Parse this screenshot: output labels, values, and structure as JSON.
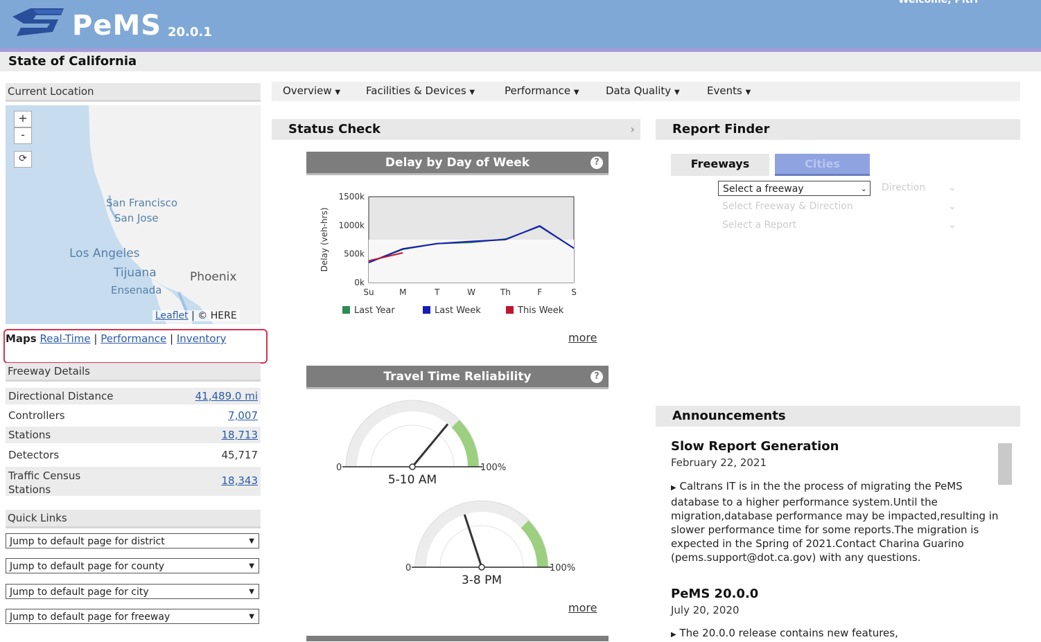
{
  "header": {
    "app_name": "PeMS",
    "version": "20.0.1",
    "welcome": "Welcome, Pitri",
    "state_title": "State of California"
  },
  "left": {
    "current_location_title": "Current Location",
    "map": {
      "zoom_in": "+",
      "zoom_out": "-",
      "cities": [
        "San Francisco",
        "San Jose",
        "Los Angeles",
        "Tijuana",
        "Ensenada",
        "Phoenix"
      ],
      "attribution_leaflet": "Leaflet",
      "attribution_here": "© HERE"
    },
    "map_links": {
      "label": "Maps",
      "realtime": "Real-Time",
      "performance": "Performance",
      "inventory": "Inventory"
    },
    "freeway_details": {
      "title": "Freeway Details",
      "rows": [
        {
          "label": "Directional Distance",
          "value": "41,489.0 mi"
        },
        {
          "label": "Controllers",
          "value": "7,007"
        },
        {
          "label": "Stations",
          "value": "18,713"
        },
        {
          "label": "Detectors",
          "value": "45,717"
        },
        {
          "label": "Traffic Census Stations",
          "value": "18,343"
        }
      ]
    },
    "quick_links": {
      "title": "Quick Links",
      "options": [
        "Jump to default page for district",
        "Jump to default page for county",
        "Jump to default page for city",
        "Jump to default page for freeway"
      ]
    }
  },
  "nav": {
    "items": [
      "Overview",
      "Facilities & Devices",
      "Performance",
      "Data Quality",
      "Events"
    ]
  },
  "status_check": {
    "title": "Status Check",
    "collapse_icon": "chevron-right-icon",
    "delay_chart_title": "Delay by Day of Week",
    "travel_time_title": "Travel Time Reliability",
    "more": "more",
    "gauges": [
      {
        "label": "5-10 AM",
        "min": "0",
        "max": "100%",
        "value_pct": 72
      },
      {
        "label": "3-8 PM",
        "min": "0",
        "max": "100%",
        "value_pct": 40
      }
    ]
  },
  "chart_data": {
    "type": "line",
    "title": "",
    "ylabel": "Delay (veh-hrs)",
    "xlabel": "",
    "categories": [
      "Su",
      "M",
      "T",
      "W",
      "Th",
      "F",
      "S"
    ],
    "y_ticks": [
      "0k",
      "500k",
      "1000k",
      "1500k"
    ],
    "ylim": [
      0,
      1500
    ],
    "series": [
      {
        "name": "Last Year",
        "color": "#2e8b57",
        "values": [
          350,
          580,
          680,
          700,
          760,
          980,
          600
        ]
      },
      {
        "name": "Last Week",
        "color": "#1a1ab8",
        "values": [
          350,
          590,
          680,
          720,
          750,
          990,
          600
        ]
      },
      {
        "name": "This Week",
        "color": "#c0142e",
        "values": [
          380,
          520,
          0,
          0,
          0,
          0,
          0
        ]
      }
    ]
  },
  "report_finder": {
    "title": "Report Finder",
    "tab_active": "Freeways",
    "tab_other": "Cities",
    "select_placeholder": "Select a freeway",
    "rows": [
      "Direction",
      "Select Freeway & Direction",
      "Select a Report"
    ]
  },
  "announcements": {
    "title": "Announcements",
    "items": [
      {
        "title": "Slow Report Generation",
        "date": "February 22, 2021",
        "body": "Caltrans IT is in the the process of migrating the PeMS database to a higher performance system.Until the migration,database performance may be impacted,resulting in slower performance time for some reports.The migration is expected in the Spring of 2021.Contact Charina Guarino (pems.support@dot.ca.gov) with any questions."
      },
      {
        "title": "PeMS 20.0.0",
        "date": "July 20, 2020",
        "body": "The 20.0.0 release contains new features,"
      }
    ]
  },
  "colors": {
    "header_blue": "#7fa8d6",
    "header_purple_line": "#a89bd9",
    "highlight_red": "#d8304d",
    "gauge_green": "#9ccf7f"
  }
}
